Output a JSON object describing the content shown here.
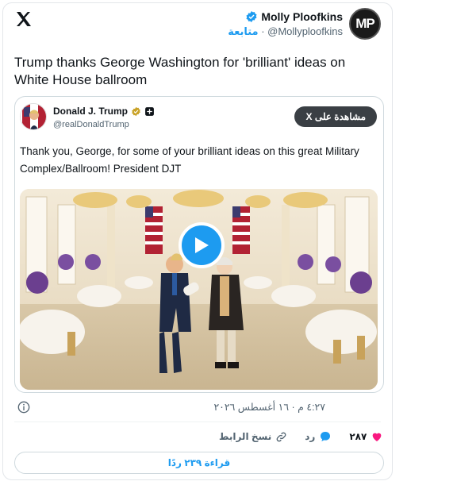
{
  "author": {
    "name": "Molly Ploofkins",
    "handle": "@Mollyploofkins",
    "follow_label": "متابعة",
    "avatar_initials": "MP"
  },
  "post": {
    "text": "Trump thanks George Washington for 'brilliant' ideas on White House ballroom"
  },
  "quoted": {
    "name": "Donald J. Trump",
    "handle": "@realDonaldTrump",
    "view_on_x": "مشاهدة على X",
    "text": "Thank you, George, for some of your brilliant ideas on this great Military Complex/Ballroom! President DJT"
  },
  "meta": {
    "timestamp": "٤:٢٧ م · ١٦ أغسطس ٢٠٢٦"
  },
  "actions": {
    "like_count": "٢٨٧",
    "reply_label": "رد",
    "copy_link_label": "نسخ الرابط"
  },
  "read_replies_label": "قراءة ٢٣٩ ردًا",
  "colors": {
    "accent": "#1d9bf0",
    "like": "#f91880",
    "verified_gold": "#c9a227",
    "muted": "#536471"
  }
}
